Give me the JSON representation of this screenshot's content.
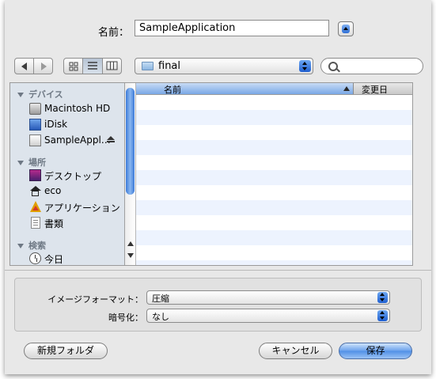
{
  "save_dialog": {
    "filename_label": "名前：",
    "filename_value": "SampleApplication"
  },
  "toolbar": {
    "location": "final",
    "search_placeholder": ""
  },
  "sidebar": {
    "sections": [
      {
        "title": "デバイス",
        "items": [
          {
            "label": "Macintosh HD",
            "icon": "hard-disk-icon"
          },
          {
            "label": "iDisk",
            "icon": "idisk-icon"
          },
          {
            "label": "SampleAppl…",
            "icon": "volume-icon",
            "eject": true
          }
        ]
      },
      {
        "title": "場所",
        "items": [
          {
            "label": "デスクトップ",
            "icon": "desktop-icon"
          },
          {
            "label": "eco",
            "icon": "home-icon"
          },
          {
            "label": "アプリケーション",
            "icon": "applications-icon"
          },
          {
            "label": "書類",
            "icon": "documents-icon"
          }
        ]
      },
      {
        "title": "検索",
        "items": [
          {
            "label": "今日",
            "icon": "clock-icon"
          }
        ]
      }
    ]
  },
  "file_list": {
    "columns": [
      "名前",
      "変更日"
    ],
    "sorted_column": "名前",
    "rows": []
  },
  "options": {
    "format_label": "イメージフォーマット：",
    "format_value": "圧縮",
    "encryption_label": "暗号化：",
    "encryption_value": "なし"
  },
  "buttons": {
    "new_folder": "新規フォルダ",
    "cancel": "キャンセル",
    "save": "保存"
  }
}
